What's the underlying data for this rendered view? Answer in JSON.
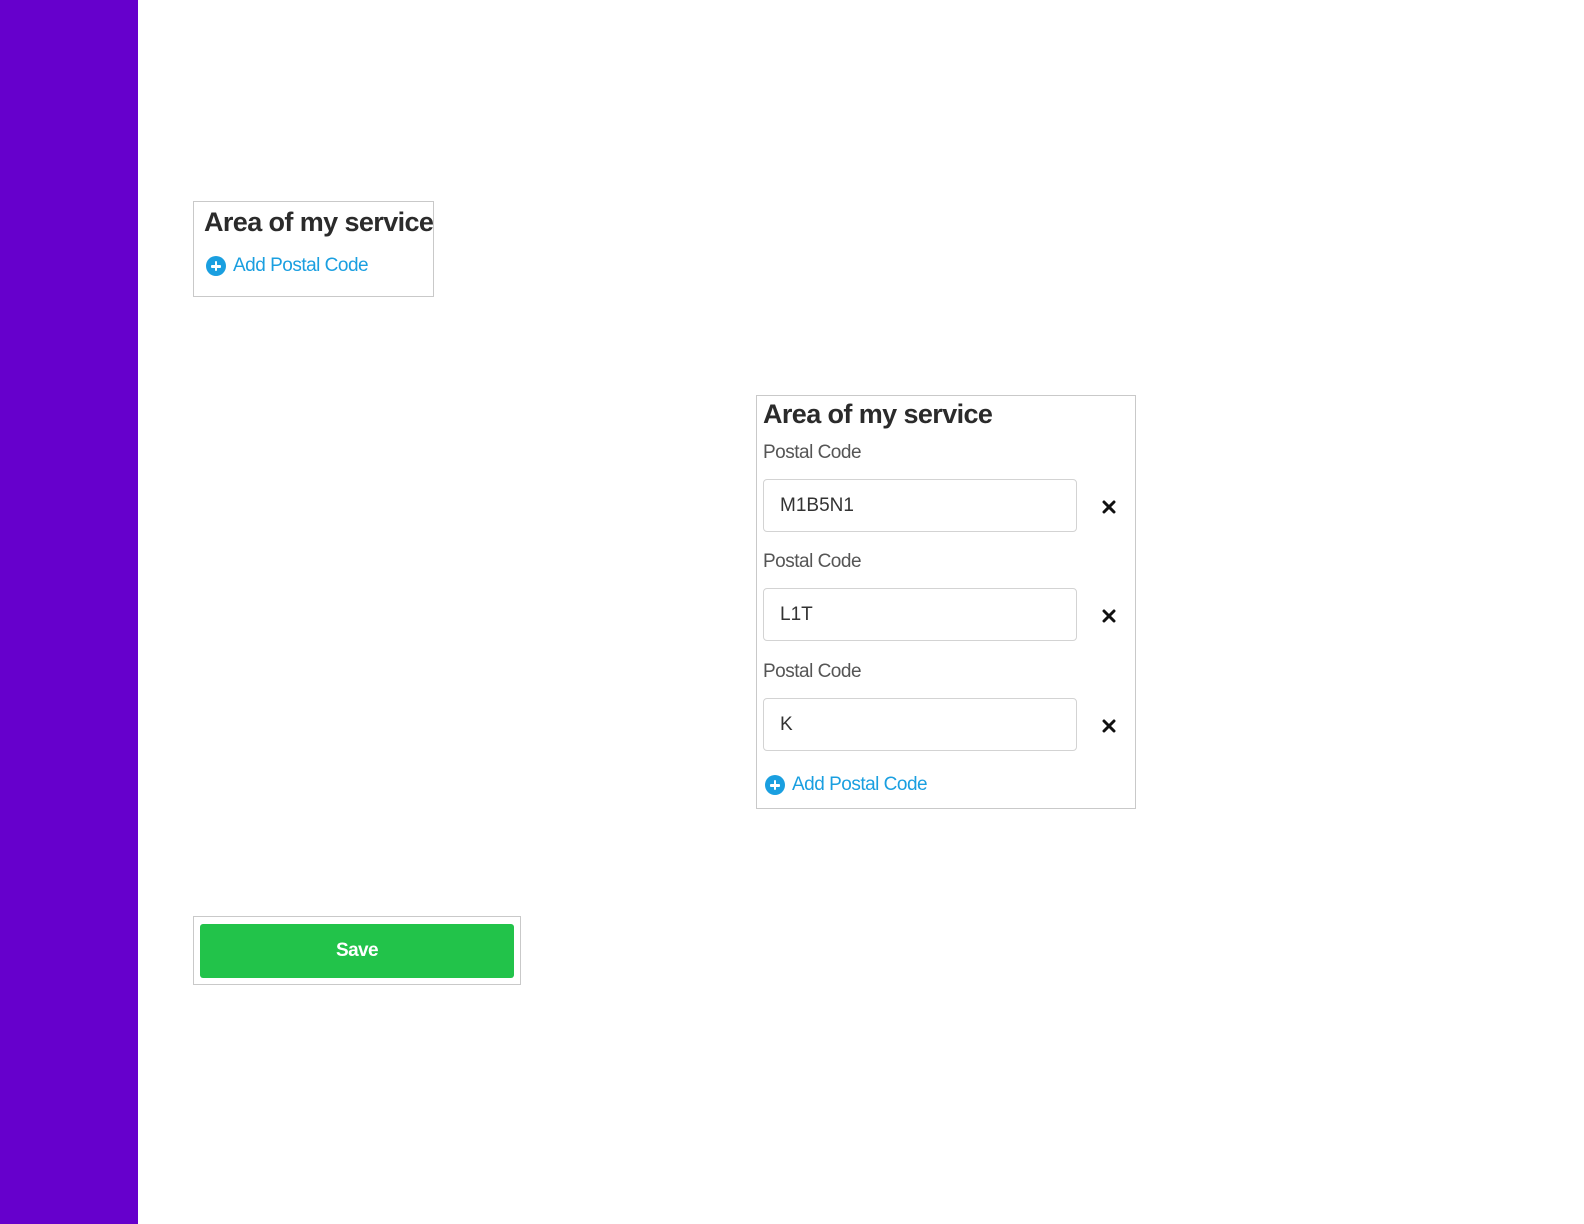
{
  "colors": {
    "sidebar": "#6600cc",
    "link": "#1a9fe0",
    "save_button": "#22c34a"
  },
  "collapsed_card": {
    "title": "Area of my service",
    "add_label": "Add Postal Code",
    "add_icon": "plus-circle-icon"
  },
  "expanded_card": {
    "title": "Area of my service",
    "postal_codes": [
      {
        "label": "Postal Code",
        "value": "M1B5N1",
        "remove_icon": "close-icon"
      },
      {
        "label": "Postal Code",
        "value": "L1T",
        "remove_icon": "close-icon"
      },
      {
        "label": "Postal Code",
        "value": "K",
        "remove_icon": "close-icon"
      }
    ],
    "add_label": "Add Postal Code",
    "add_icon": "plus-circle-icon"
  },
  "save": {
    "label": "Save"
  }
}
